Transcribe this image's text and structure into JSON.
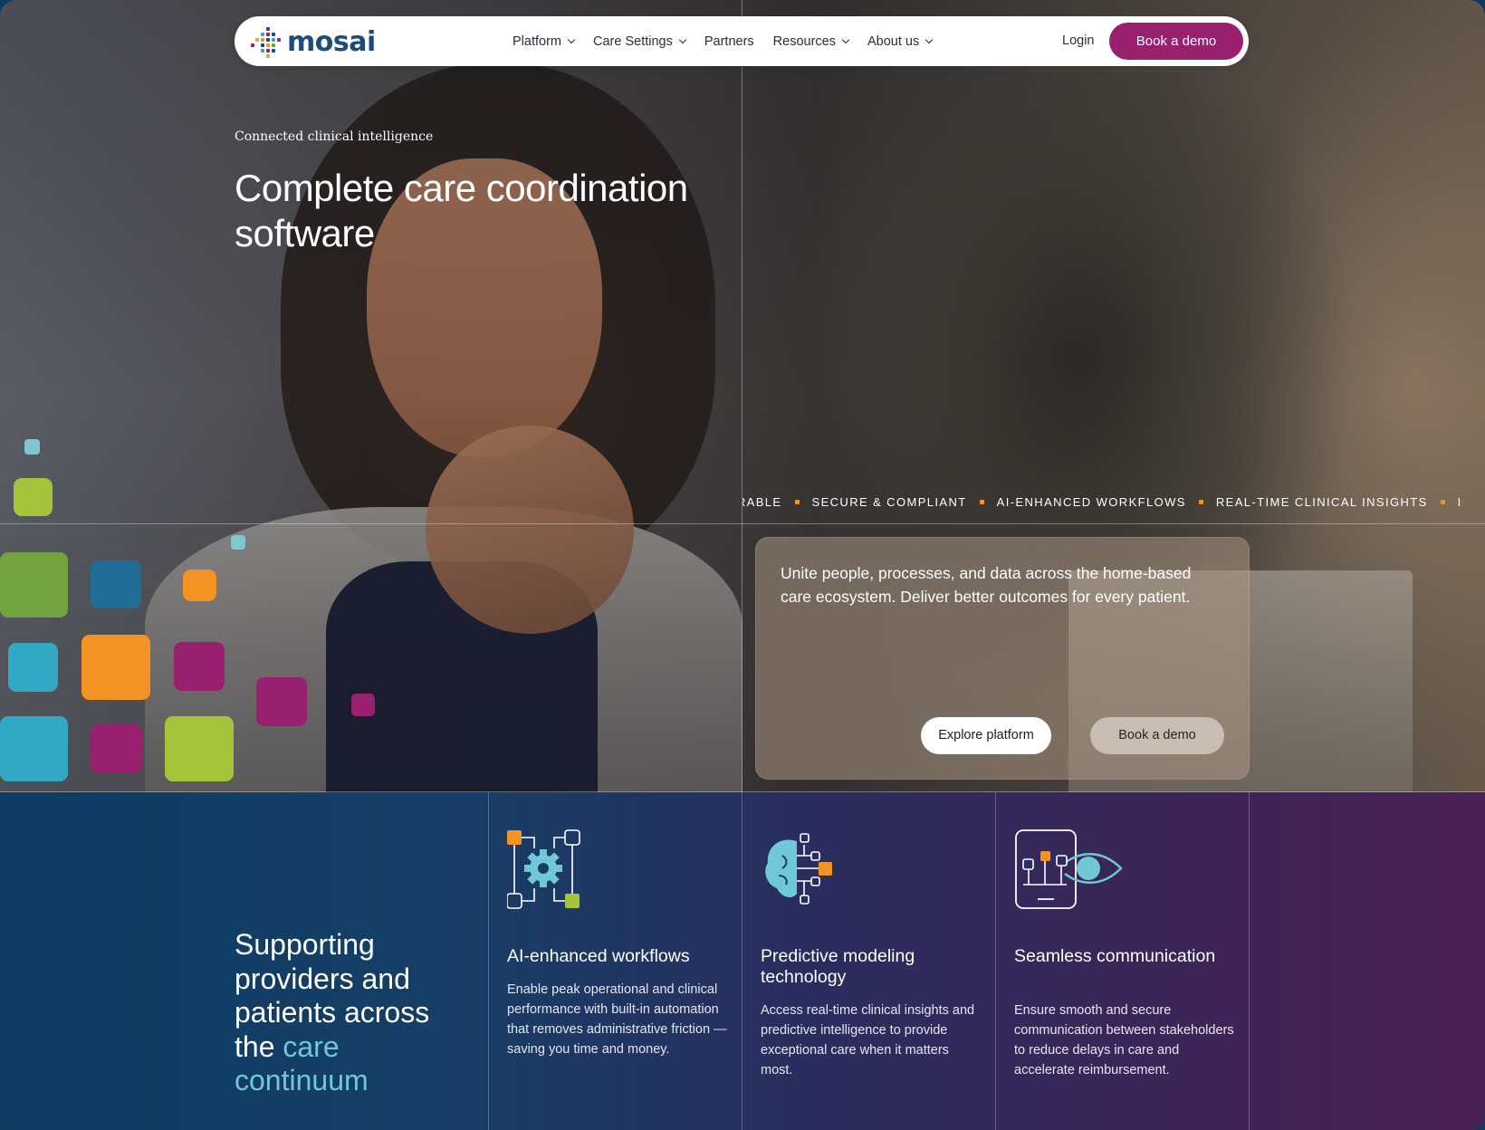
{
  "nav": {
    "logo_text": "mosai",
    "items": [
      {
        "label": "Platform",
        "has_dropdown": true
      },
      {
        "label": "Care Settings",
        "has_dropdown": true
      },
      {
        "label": "Partners",
        "has_dropdown": false
      },
      {
        "label": "Resources",
        "has_dropdown": true
      },
      {
        "label": "About us",
        "has_dropdown": true
      }
    ],
    "login_label": "Login",
    "demo_label": "Book a demo"
  },
  "hero": {
    "eyebrow": "Connected clinical intelligence",
    "title": "Complete care coordination software",
    "ticker": [
      "TEROPERABLE",
      "SECURE & COMPLIANT",
      "AI-ENHANCED WORKFLOWS",
      "REAL-TIME CLINICAL INSIGHTS",
      "I"
    ],
    "card_text": "Unite people, processes, and data across the home-based care ecosystem. Deliver better outcomes for every patient.",
    "explore_label": "Explore platform",
    "demo_label": "Book a demo"
  },
  "support": {
    "title_part1": "Supporting providers and patients across the",
    "title_highlight": "care continuum"
  },
  "features": [
    {
      "icon": "gear-network-icon",
      "title": "AI-enhanced workflows",
      "description": "Enable peak operational and clinical performance with built-in automation that removes administrative friction — saving you time and money."
    },
    {
      "icon": "brain-network-icon",
      "title": "Predictive modeling technology",
      "description": "Access real-time clinical insights and predictive intelligence to provide exceptional care when it matters most."
    },
    {
      "icon": "phone-eye-icon",
      "title": "Seamless communication",
      "description": "Ensure smooth and secure communication between stakeholders to reduce delays in care and accelerate reimbursement."
    }
  ],
  "colors": {
    "brand_magenta": "#98206e",
    "brand_navy": "#1e4c7a",
    "orange": "#f39326",
    "teal": "#6fc7d7",
    "lime": "#a6c43b",
    "green": "#74a23f",
    "blue": "#1f6d94",
    "cyan": "#31a9c4"
  }
}
